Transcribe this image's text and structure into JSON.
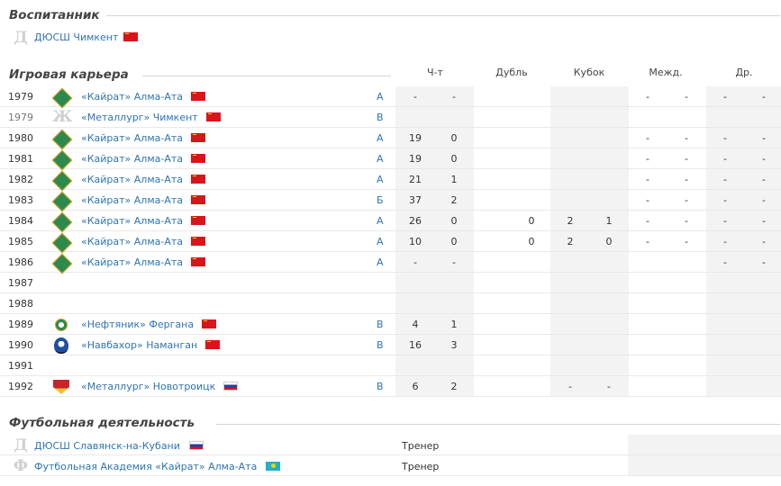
{
  "sections": {
    "youth": "Воспитанник",
    "career": "Игровая карьера",
    "activity": "Футбольная деятельность"
  },
  "youth": {
    "letter": "Д",
    "club": "ДЮСШ Чимкент",
    "flag": "flag-ussr"
  },
  "headers": {
    "league": "Ч-т",
    "reserve": "Дубль",
    "cup": "Кубок",
    "intl": "Межд.",
    "other": "Др."
  },
  "career": [
    {
      "year": "1979",
      "club": "«Кайрат» Алма-Ата",
      "emblem": "kairat-emblem-icon",
      "flag": "flag-ussr",
      "level": "А",
      "l1": "-",
      "l2": "-",
      "r1": "",
      "r2": "",
      "c1": "",
      "c2": "",
      "i1": "-",
      "i2": "-",
      "o1": "-",
      "o2": "-"
    },
    {
      "year": "1979",
      "club": "«Металлург» Чимкент",
      "emblem": "letter-zh",
      "letter": "Ж",
      "flag": "flag-ussr",
      "level": "В",
      "l1": "",
      "l2": "",
      "r1": "",
      "r2": "",
      "c1": "",
      "c2": "",
      "i1": "",
      "i2": "",
      "o1": "",
      "o2": "",
      "muted": true
    },
    {
      "year": "1980",
      "club": "«Кайрат» Алма-Ата",
      "emblem": "kairat-emblem-icon",
      "flag": "flag-ussr",
      "level": "А",
      "l1": "19",
      "l2": "0",
      "r1": "",
      "r2": "",
      "c1": "",
      "c2": "",
      "i1": "-",
      "i2": "-",
      "o1": "-",
      "o2": "-"
    },
    {
      "year": "1981",
      "club": "«Кайрат» Алма-Ата",
      "emblem": "kairat-emblem-icon",
      "flag": "flag-ussr",
      "level": "А",
      "l1": "19",
      "l2": "0",
      "r1": "",
      "r2": "",
      "c1": "",
      "c2": "",
      "i1": "-",
      "i2": "-",
      "o1": "-",
      "o2": "-"
    },
    {
      "year": "1982",
      "club": "«Кайрат» Алма-Ата",
      "emblem": "kairat-emblem-icon",
      "flag": "flag-ussr",
      "level": "А",
      "l1": "21",
      "l2": "1",
      "r1": "",
      "r2": "",
      "c1": "",
      "c2": "",
      "i1": "-",
      "i2": "-",
      "o1": "-",
      "o2": "-"
    },
    {
      "year": "1983",
      "club": "«Кайрат» Алма-Ата",
      "emblem": "kairat-emblem-icon",
      "flag": "flag-ussr",
      "level": "Б",
      "l1": "37",
      "l2": "2",
      "r1": "",
      "r2": "",
      "c1": "",
      "c2": "",
      "i1": "-",
      "i2": "-",
      "o1": "-",
      "o2": "-"
    },
    {
      "year": "1984",
      "club": "«Кайрат» Алма-Ата",
      "emblem": "kairat-emblem-icon",
      "flag": "flag-ussr",
      "level": "А",
      "l1": "26",
      "l2": "0",
      "r1": "",
      "r2": "0",
      "c1": "2",
      "c2": "1",
      "i1": "-",
      "i2": "-",
      "o1": "-",
      "o2": "-"
    },
    {
      "year": "1985",
      "club": "«Кайрат» Алма-Ата",
      "emblem": "kairat-emblem-icon",
      "flag": "flag-ussr",
      "level": "А",
      "l1": "10",
      "l2": "0",
      "r1": "",
      "r2": "0",
      "c1": "2",
      "c2": "0",
      "i1": "-",
      "i2": "-",
      "o1": "-",
      "o2": "-"
    },
    {
      "year": "1986",
      "club": "«Кайрат» Алма-Ата",
      "emblem": "kairat-emblem-icon",
      "flag": "flag-ussr",
      "level": "А",
      "l1": "-",
      "l2": "-",
      "r1": "",
      "r2": "",
      "c1": "",
      "c2": "",
      "i1": "",
      "i2": "",
      "o1": "-",
      "o2": "-"
    },
    {
      "year": "1987",
      "club": "",
      "emblem": "",
      "flag": "",
      "level": "",
      "l1": "",
      "l2": "",
      "r1": "",
      "r2": "",
      "c1": "",
      "c2": "",
      "i1": "",
      "i2": "",
      "o1": "",
      "o2": ""
    },
    {
      "year": "1988",
      "club": "",
      "emblem": "",
      "flag": "",
      "level": "",
      "l1": "",
      "l2": "",
      "r1": "",
      "r2": "",
      "c1": "",
      "c2": "",
      "i1": "",
      "i2": "",
      "o1": "",
      "o2": ""
    },
    {
      "year": "1989",
      "club": "«Нефтяник» Фергана",
      "emblem": "neftyanik-emblem-icon",
      "flag": "flag-ussr",
      "level": "В",
      "l1": "4",
      "l2": "1",
      "r1": "",
      "r2": "",
      "c1": "",
      "c2": "",
      "i1": "",
      "i2": "",
      "o1": "",
      "o2": ""
    },
    {
      "year": "1990",
      "club": "«Навбахор» Наманган",
      "emblem": "navbahor-emblem-icon",
      "flag": "flag-ussr",
      "level": "В",
      "l1": "16",
      "l2": "3",
      "r1": "",
      "r2": "",
      "c1": "",
      "c2": "",
      "i1": "",
      "i2": "",
      "o1": "",
      "o2": ""
    },
    {
      "year": "1991",
      "club": "",
      "emblem": "",
      "flag": "",
      "level": "",
      "l1": "",
      "l2": "",
      "r1": "",
      "r2": "",
      "c1": "",
      "c2": "",
      "i1": "",
      "i2": "",
      "o1": "",
      "o2": ""
    },
    {
      "year": "1992",
      "club": "«Металлург» Новотроицк",
      "emblem": "metallurg-novotroitsk-emblem-icon",
      "flag": "flag-ru",
      "level": "В",
      "l1": "6",
      "l2": "2",
      "r1": "",
      "r2": "",
      "c1": "-",
      "c2": "-",
      "i1": "",
      "i2": "",
      "o1": "",
      "o2": ""
    }
  ],
  "activity": [
    {
      "letter": "Д",
      "club": "ДЮСШ Славянск-на-Кубани",
      "flag": "flag-ru",
      "role": "Тренер"
    },
    {
      "letter": "Ф",
      "club": "Футбольная Академия «Кайрат» Алма-Ата",
      "flag": "flag-kz",
      "role": "Тренер"
    }
  ]
}
